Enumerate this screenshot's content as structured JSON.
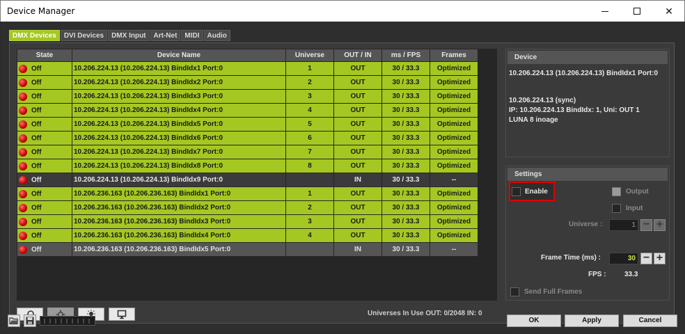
{
  "window": {
    "title": "Device Manager"
  },
  "tabs": [
    "DMX Devices",
    "DVI Devices",
    "DMX Input",
    "Art-Net",
    "MIDI",
    "Audio"
  ],
  "table": {
    "columns": [
      "State",
      "Device Name",
      "Universe",
      "OUT / IN",
      "ms / FPS",
      "Frames"
    ],
    "rows": [
      {
        "state": "Off",
        "name": "10.206.224.13 (10.206.224.13) BindIdx1 Port:0",
        "universe": "1",
        "dir": "OUT",
        "fps": "30 / 33.3",
        "frames": "Optimized",
        "style": "green"
      },
      {
        "state": "Off",
        "name": "10.206.224.13 (10.206.224.13) BindIdx2 Port:0",
        "universe": "2",
        "dir": "OUT",
        "fps": "30 / 33.3",
        "frames": "Optimized",
        "style": "green"
      },
      {
        "state": "Off",
        "name": "10.206.224.13 (10.206.224.13) BindIdx3 Port:0",
        "universe": "3",
        "dir": "OUT",
        "fps": "30 / 33.3",
        "frames": "Optimized",
        "style": "green"
      },
      {
        "state": "Off",
        "name": "10.206.224.13 (10.206.224.13) BindIdx4 Port:0",
        "universe": "4",
        "dir": "OUT",
        "fps": "30 / 33.3",
        "frames": "Optimized",
        "style": "green"
      },
      {
        "state": "Off",
        "name": "10.206.224.13 (10.206.224.13) BindIdx5 Port:0",
        "universe": "5",
        "dir": "OUT",
        "fps": "30 / 33.3",
        "frames": "Optimized",
        "style": "green"
      },
      {
        "state": "Off",
        "name": "10.206.224.13 (10.206.224.13) BindIdx6 Port:0",
        "universe": "6",
        "dir": "OUT",
        "fps": "30 / 33.3",
        "frames": "Optimized",
        "style": "green"
      },
      {
        "state": "Off",
        "name": "10.206.224.13 (10.206.224.13) BindIdx7 Port:0",
        "universe": "7",
        "dir": "OUT",
        "fps": "30 / 33.3",
        "frames": "Optimized",
        "style": "green"
      },
      {
        "state": "Off",
        "name": "10.206.224.13 (10.206.224.13) BindIdx8 Port:0",
        "universe": "8",
        "dir": "OUT",
        "fps": "30 / 33.3",
        "frames": "Optimized",
        "style": "green"
      },
      {
        "state": "Off",
        "name": "10.206.224.13 (10.206.224.13) BindIdx9 Port:0",
        "universe": "",
        "dir": "IN",
        "fps": "30 / 33.3",
        "frames": "--",
        "style": "dark"
      },
      {
        "state": "Off",
        "name": "10.206.236.163 (10.206.236.163) BindIdx1 Port:0",
        "universe": "1",
        "dir": "OUT",
        "fps": "30 / 33.3",
        "frames": "Optimized",
        "style": "green"
      },
      {
        "state": "Off",
        "name": "10.206.236.163 (10.206.236.163) BindIdx2 Port:0",
        "universe": "2",
        "dir": "OUT",
        "fps": "30 / 33.3",
        "frames": "Optimized",
        "style": "green"
      },
      {
        "state": "Off",
        "name": "10.206.236.163 (10.206.236.163) BindIdx3 Port:0",
        "universe": "3",
        "dir": "OUT",
        "fps": "30 / 33.3",
        "frames": "Optimized",
        "style": "green"
      },
      {
        "state": "Off",
        "name": "10.206.236.163 (10.206.236.163) BindIdx4 Port:0",
        "universe": "4",
        "dir": "OUT",
        "fps": "30 / 33.3",
        "frames": "Optimized",
        "style": "green"
      },
      {
        "state": "Off",
        "name": "10.206.236.163 (10.206.236.163) BindIdx5 Port:0",
        "universe": "",
        "dir": "IN",
        "fps": "30 / 33.3",
        "frames": "--",
        "style": "gray"
      }
    ]
  },
  "toolbar_icons": [
    "search-icon",
    "gear-icon",
    "light-bulb-icon",
    "monitor-icon"
  ],
  "status": {
    "universes": "Universes In Use OUT: 0/2048  IN: 0"
  },
  "device": {
    "header": "Device",
    "name": "10.206.224.13 (10.206.224.13) BindIdx1 Port:0",
    "sync": "10.206.224.13 (sync)",
    "ip": "IP: 10.206.224.13  BindIdx: 1, Uni: OUT 1",
    "model": "LUNA 8 inoage"
  },
  "settings": {
    "header": "Settings",
    "enable": "Enable",
    "output": "Output",
    "input": "Input",
    "universe_label": "Universe :",
    "universe_value": "1",
    "frame_time_label": "Frame Time (ms) :",
    "frame_time_value": "30",
    "fps_label": "FPS :",
    "fps_value": "33.3",
    "send_full_frames": "Send Full Frames"
  },
  "footer": {
    "ok": "OK",
    "apply": "Apply",
    "cancel": "Cancel"
  },
  "colors": {
    "accent": "#a5c722",
    "highlight_border": "#e00000",
    "frame_value": "#c8e84a"
  }
}
